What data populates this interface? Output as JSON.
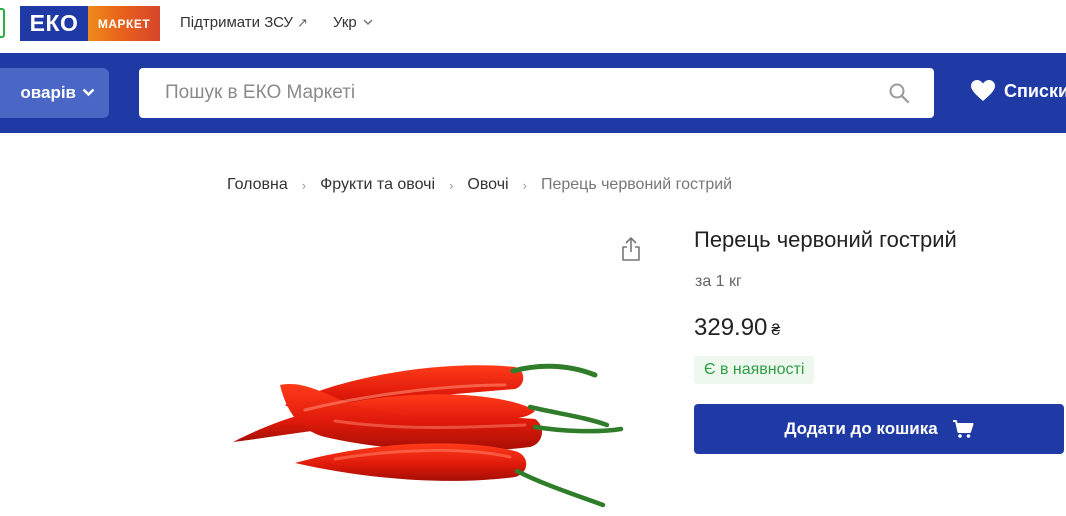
{
  "topbar": {
    "logo_eko": "ЕКО",
    "logo_market": "МАРКЕТ",
    "support_label": "Підтримати ЗСУ",
    "support_icon": "external-arrow-icon",
    "lang_label": "Укр"
  },
  "header": {
    "catalog_label": "оварів",
    "search_placeholder": "Пошук в ЕКО Маркеті",
    "lists_label": "Списки"
  },
  "breadcrumb": [
    "Головна",
    "Фрукти та овочі",
    "Овочі",
    "Перець червоний гострий"
  ],
  "product": {
    "title": "Перець червоний гострий",
    "unit": "за 1 кг",
    "price": "329.90",
    "currency": "₴",
    "stock": "Є в наявності",
    "add_to_cart": "Додати до кошика"
  },
  "colors": {
    "brand_blue": "#1f3aa4",
    "catalog_blue": "#4a67c6",
    "stock_green": "#2e9e45"
  }
}
